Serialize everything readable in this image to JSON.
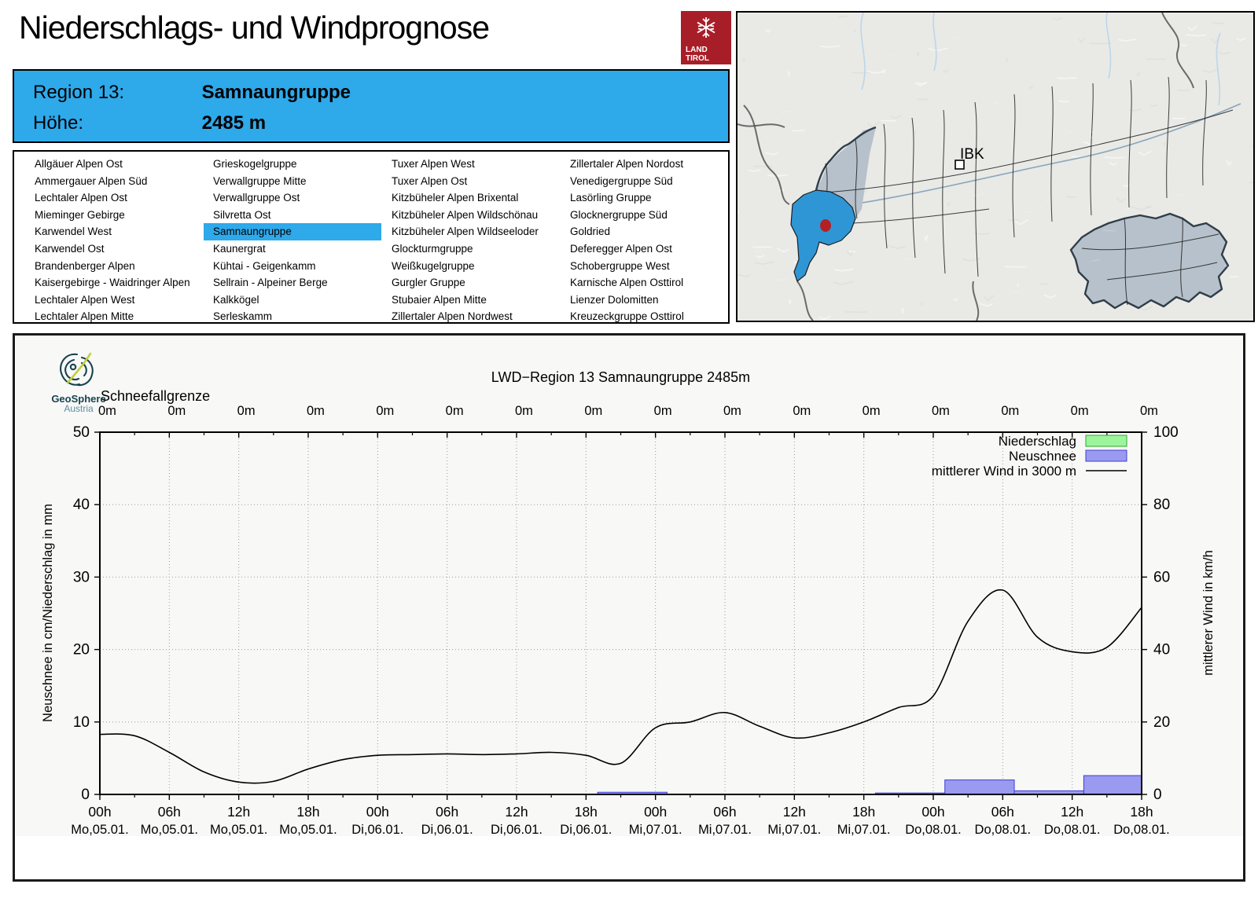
{
  "header": {
    "title": "Niederschlags- und Windprognose"
  },
  "land_tirol_logo": {
    "line1": "LAND",
    "line2": "TIROL"
  },
  "region_info": {
    "region_label": "Region 13:",
    "region_name": "Samnaungruppe",
    "altitude_label": "Höhe:",
    "altitude_value": "2485 m"
  },
  "region_list": {
    "selected": "Samnaungruppe",
    "columns": [
      [
        "Allgäuer Alpen Ost",
        "Ammergauer Alpen Süd",
        "Lechtaler Alpen Ost",
        "Mieminger Gebirge",
        "Karwendel West",
        "Karwendel Ost",
        "Brandenberger Alpen",
        "Kaisergebirge - Waidringer Alpen",
        "Lechtaler Alpen West",
        "Lechtaler Alpen Mitte"
      ],
      [
        "Grieskogelgruppe",
        "Verwallgruppe Mitte",
        "Verwallgruppe Ost",
        "Silvretta Ost",
        "Samnaungruppe",
        "Kaunergrat",
        "Kühtai - Geigenkamm",
        "Sellrain - Alpeiner Berge",
        "Kalkkögel",
        "Serleskamm"
      ],
      [
        "Tuxer Alpen West",
        "Tuxer Alpen Ost",
        "Kitzbüheler Alpen Brixental",
        "Kitzbüheler Alpen Wildschönau",
        "Kitzbüheler Alpen Wildseeloder",
        "Glockturmgruppe",
        "Weißkugelgruppe",
        "Gurgler Gruppe",
        "Stubaier Alpen Mitte",
        "Zillertaler Alpen Nordwest"
      ],
      [
        "Zillertaler Alpen Nordost",
        "Venedigergruppe Süd",
        "Lasörling Gruppe",
        "Glocknergruppe Süd",
        "Goldried",
        "Deferegger Alpen Ost",
        "Schobergruppe West",
        "Karnische Alpen Osttirol",
        "Lienzer Dolomitten",
        "Kreuzeckgruppe Osttirol"
      ]
    ]
  },
  "map": {
    "city_label": "IBK"
  },
  "geosphere_logo": {
    "name": "GeoSphere",
    "country": "Austria"
  },
  "colors": {
    "accent_blue": "#2ea9ea",
    "brand_red": "#a81e28",
    "snow_bar_fill": "#9a9af0",
    "snow_bar_stroke": "#3f3fd4",
    "precip_bar_fill": "#9cf59c",
    "precip_bar_stroke": "#2aaa2a",
    "map_region_fill": "#b7c1cb",
    "map_highlight": "#2f96d5",
    "marker_red": "#b32024"
  },
  "chart_data": {
    "type": "line",
    "title": "LWD−Region 13 Samnaungruppe 2485m",
    "top_axis": {
      "label": "Schneefallgrenze",
      "values": [
        "0m",
        "0m",
        "0m",
        "0m",
        "0m",
        "0m",
        "0m",
        "0m",
        "0m",
        "0m",
        "0m",
        "0m",
        "0m",
        "0m",
        "0m",
        "0m"
      ]
    },
    "ylabel_left": "Neuschnee in cm/Niederschlag in mm",
    "ylabel_right": "mittlerer Wind in km/h",
    "ylim_left": [
      0,
      50
    ],
    "ylim_right": [
      0,
      100
    ],
    "yticks_left": [
      0,
      10,
      20,
      30,
      40,
      50
    ],
    "yticks_right": [
      0,
      20,
      40,
      60,
      80,
      100
    ],
    "x_range_hours": [
      0,
      90
    ],
    "grid": true,
    "legend_position": "top-right-inside",
    "x_ticks": [
      {
        "time": "00h",
        "date": "Mo,05.01."
      },
      {
        "time": "06h",
        "date": "Mo,05.01."
      },
      {
        "time": "12h",
        "date": "Mo,05.01."
      },
      {
        "time": "18h",
        "date": "Mo,05.01."
      },
      {
        "time": "00h",
        "date": "Di,06.01."
      },
      {
        "time": "06h",
        "date": "Di,06.01."
      },
      {
        "time": "12h",
        "date": "Di,06.01."
      },
      {
        "time": "18h",
        "date": "Di,06.01."
      },
      {
        "time": "00h",
        "date": "Mi,07.01."
      },
      {
        "time": "06h",
        "date": "Mi,07.01."
      },
      {
        "time": "12h",
        "date": "Mi,07.01."
      },
      {
        "time": "18h",
        "date": "Mi,07.01."
      },
      {
        "time": "00h",
        "date": "Do,08.01."
      },
      {
        "time": "06h",
        "date": "Do,08.01."
      },
      {
        "time": "12h",
        "date": "Do,08.01."
      },
      {
        "time": "18h",
        "date": "Do,08.01."
      }
    ],
    "legend": [
      {
        "label": "Niederschlag",
        "swatch": "box-green"
      },
      {
        "label": "Neuschnee",
        "swatch": "box-blue"
      },
      {
        "label": "mittlerer Wind in 3000 m",
        "swatch": "line"
      }
    ],
    "series": [
      {
        "name": "mittlerer Wind in 3000 m",
        "type": "line",
        "axis": "right",
        "unit": "km/h",
        "start_hour": 0,
        "step_hours": 3,
        "values": [
          16.6,
          16.2,
          11.6,
          6.2,
          3.4,
          3.6,
          7.0,
          9.6,
          10.8,
          11.0,
          11.2,
          11.0,
          11.2,
          11.6,
          10.8,
          8.6,
          18.4,
          20.0,
          22.6,
          18.8,
          15.6,
          17.0,
          20.0,
          24.0,
          27.2,
          47.8,
          56.4,
          43.4,
          39.4,
          40.6,
          51.6
        ]
      },
      {
        "name": "Neuschnee",
        "type": "bar",
        "axis": "left",
        "unit": "cm",
        "bars": [
          {
            "from_h": 43,
            "to_h": 49,
            "value": 0.3
          },
          {
            "from_h": 67,
            "to_h": 73,
            "value": 0.2
          },
          {
            "from_h": 73,
            "to_h": 79,
            "value": 2.0
          },
          {
            "from_h": 79,
            "to_h": 85,
            "value": 0.5
          },
          {
            "from_h": 85,
            "to_h": 90,
            "value": 2.6
          }
        ]
      },
      {
        "name": "Niederschlag",
        "type": "bar",
        "axis": "left",
        "unit": "mm",
        "bars": []
      }
    ]
  }
}
